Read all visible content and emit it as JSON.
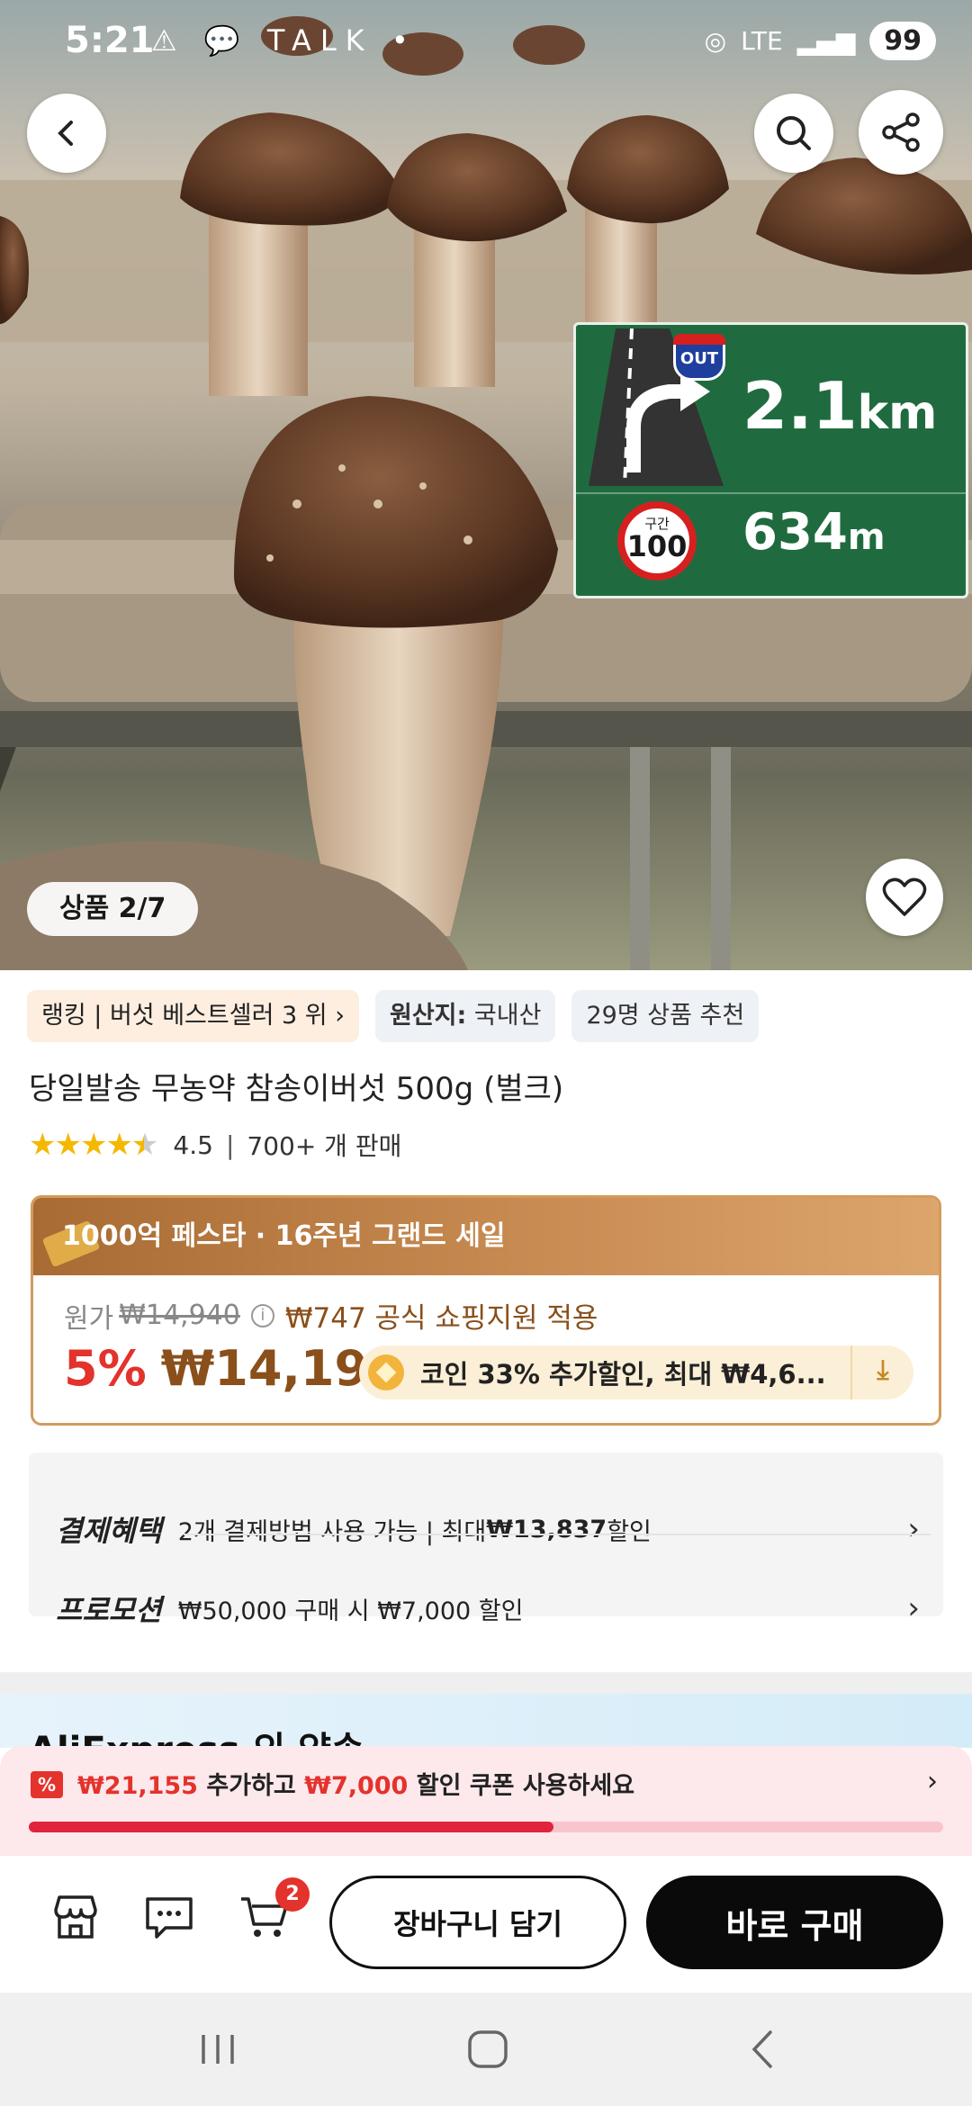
{
  "status_bar": {
    "time": "5:21",
    "left_icons": "⚠ 💬 TALK •",
    "network": "LTE",
    "battery": "99"
  },
  "hero": {
    "counter": "상품 2/7",
    "nav_sign": {
      "exit_badge": "OUT",
      "distance1_value": "2.1",
      "distance1_unit": "km",
      "speed_zone": "구간",
      "speed_limit": "100",
      "distance2_value": "634",
      "distance2_unit": "m"
    }
  },
  "chips": {
    "ranking": "랭킹 | 버섯 베스트셀러 3 위",
    "origin_label": "원산지:",
    "origin_value": "국내산",
    "recommend": "29명 상품 추천"
  },
  "product": {
    "title": "당일발송 무농약 참송이버섯 500g (벌크)",
    "rating_value": "4.5",
    "rating_stars": 4.5,
    "sales": "700+ 개 판매"
  },
  "price_card": {
    "banner": "1000억 페스타 · 16주년 그랜드 세일",
    "original_label": "원가",
    "original_price": "₩14,940",
    "support_text": "₩747 공식 쇼핑지원 적용",
    "discount": "5%",
    "price": "₩14,193",
    "coin_text": "코인 33% 추가할인, 최대 ₩4,6..."
  },
  "benefits": [
    {
      "label": "결제혜택",
      "text_pre": "2개 결제방법 사용 가능 | 최대 ",
      "text_bold": "₩13,837",
      "text_post": " 할인"
    },
    {
      "label": "프로모션",
      "text_pre": "₩50,000 구매 시 ₩7,000 할인",
      "text_bold": "",
      "text_post": ""
    }
  ],
  "section_title_partial": "AliExpress 의 약속",
  "coupon": {
    "icon": "%",
    "amount": "₩21,155",
    "mid": " 추가하고 ",
    "discount": "₩7,000",
    "tail": " 할인 쿠폰 사용하세요",
    "progress": 0.574
  },
  "bottom_bar": {
    "cart_count": "2",
    "add_to_cart": "장바구니 담기",
    "buy_now": "바로 구매"
  },
  "colors": {
    "accent_red": "#e4322c",
    "price_brown": "#8a4f1a",
    "sign_green": "#1f6b3f"
  }
}
